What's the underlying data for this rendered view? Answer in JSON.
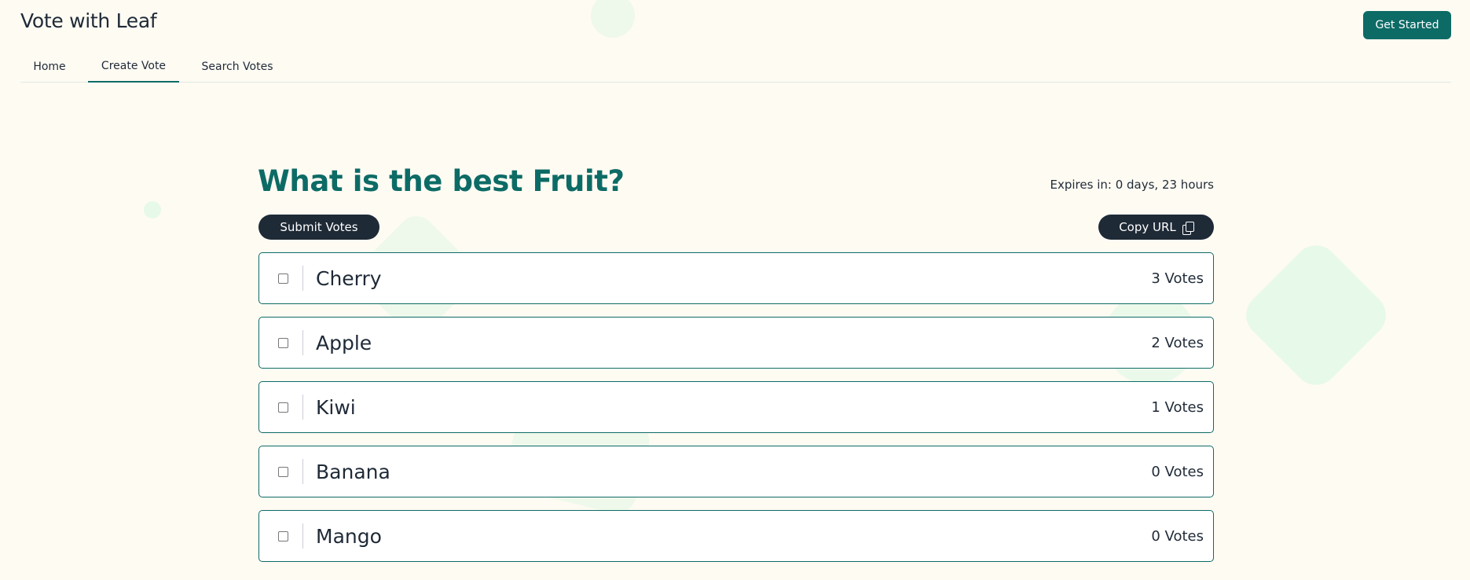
{
  "header": {
    "brand": "Vote with Leaf",
    "cta_label": "Get Started"
  },
  "nav": {
    "tabs": [
      {
        "label": "Home",
        "active": false
      },
      {
        "label": "Create Vote",
        "active": true
      },
      {
        "label": "Search Votes",
        "active": false
      }
    ]
  },
  "poll": {
    "title": "What is the best Fruit?",
    "expires": "Expires in: 0 days, 23 hours",
    "submit_label": "Submit Votes",
    "copy_label": "Copy URL",
    "options": [
      {
        "name": "Cherry",
        "votes": "3 Votes",
        "checked": false
      },
      {
        "name": "Apple",
        "votes": "2 Votes",
        "checked": false
      },
      {
        "name": "Kiwi",
        "votes": "1 Votes",
        "checked": false
      },
      {
        "name": "Banana",
        "votes": "0 Votes",
        "checked": false
      },
      {
        "name": "Mango",
        "votes": "0 Votes",
        "checked": false
      }
    ]
  },
  "colors": {
    "accent": "#0d6b66",
    "dark": "#1f2a37",
    "background": "#fefbf3",
    "decor": "#e3f8e6"
  },
  "icons": {
    "copy": "copy-icon"
  }
}
